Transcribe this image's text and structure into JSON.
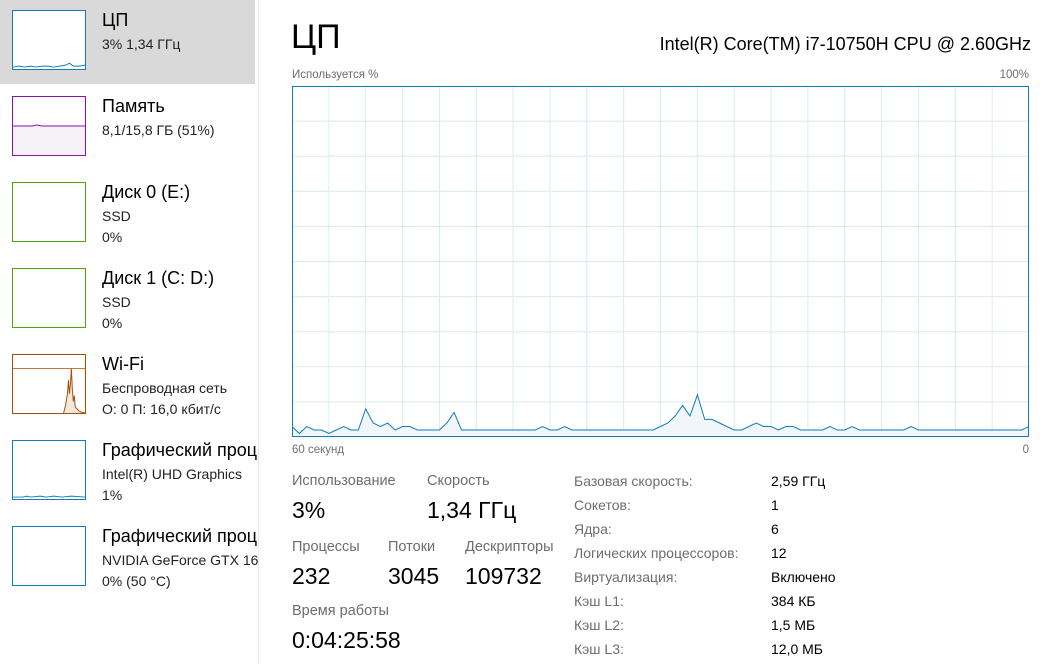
{
  "sidebar": {
    "items": [
      {
        "title": "ЦП",
        "line1": "3%  1,34 ГГц",
        "line2": "",
        "color": "#117dbb"
      },
      {
        "title": "Память",
        "line1": "8,1/15,8 ГБ (51%)",
        "line2": "",
        "color": "#8b12ae"
      },
      {
        "title": "Диск 0 (E:)",
        "line1": "SSD",
        "line2": "0%",
        "color": "#4da60c"
      },
      {
        "title": "Диск 1 (C: D:)",
        "line1": "SSD",
        "line2": "0%",
        "color": "#4da60c"
      },
      {
        "title": "Wi-Fi",
        "line1": "Беспроводная сеть",
        "line2": "О: 0  П: 16,0 кбит/с",
        "color": "#a74f01"
      },
      {
        "title": "Графический проц",
        "line1": "Intel(R) UHD Graphics",
        "line2": "1%",
        "color": "#117dbb"
      },
      {
        "title": "Графический проц",
        "line1": "NVIDIA GeForce GTX 16",
        "line2": "0%  (50 °C)",
        "color": "#117dbb"
      }
    ]
  },
  "main": {
    "title": "ЦП",
    "cpu_model": "Intel(R) Core(TM) i7-10750H CPU @ 2.60GHz",
    "graph": {
      "y_label": "Используется %",
      "y_max_label": "100%",
      "x_left_label": "60 секунд",
      "x_right_label": "0",
      "line_color": "#117dbb",
      "fill_color": "#f1f6fa",
      "grid_color": "#d9eaf4",
      "usage_percent": [
        3,
        1,
        3,
        2,
        2,
        1,
        2,
        3,
        2,
        2,
        8,
        4,
        3,
        4,
        2,
        3,
        3,
        2,
        2,
        2,
        2,
        4,
        7,
        2,
        2,
        2,
        2,
        2,
        2,
        2,
        2,
        2,
        2,
        2,
        3,
        2,
        2,
        3,
        2,
        2,
        2,
        2,
        2,
        2,
        2,
        2,
        2,
        2,
        2,
        2,
        3,
        4,
        6,
        9,
        6,
        12,
        5,
        5,
        4,
        3,
        2,
        2,
        3,
        4,
        3,
        3,
        2,
        3,
        3,
        2,
        2,
        2,
        2,
        3,
        2,
        2,
        3,
        2,
        2,
        2,
        2,
        2,
        2,
        2,
        3,
        2,
        2,
        2,
        2,
        2,
        2,
        2,
        2,
        2,
        2,
        2,
        2,
        2,
        2,
        2,
        3
      ]
    },
    "stats": {
      "usage_label": "Использование",
      "usage_value": "3%",
      "speed_label": "Скорость",
      "speed_value": "1,34 ГГц",
      "processes_label": "Процессы",
      "processes_value": "232",
      "threads_label": "Потоки",
      "threads_value": "3045",
      "handles_label": "Дескрипторы",
      "handles_value": "109732",
      "uptime_label": "Время работы",
      "uptime_value": "0:04:25:58"
    },
    "specs": [
      {
        "label": "Базовая скорость:",
        "value": "2,59 ГГц"
      },
      {
        "label": "Сокетов:",
        "value": "1"
      },
      {
        "label": "Ядра:",
        "value": "6"
      },
      {
        "label": "Логических процессоров:",
        "value": "12"
      },
      {
        "label": "Виртуализация:",
        "value": "Включено"
      },
      {
        "label": "Кэш L1:",
        "value": "384 КБ"
      },
      {
        "label": "Кэш L2:",
        "value": "1,5 МБ"
      },
      {
        "label": "Кэш L3:",
        "value": "12,0 МБ"
      }
    ]
  }
}
